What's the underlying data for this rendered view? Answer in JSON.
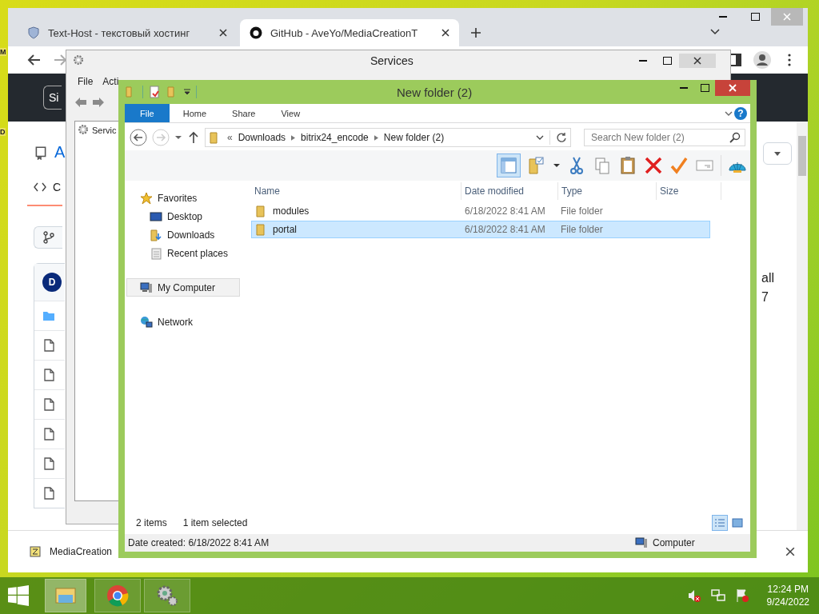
{
  "desktop_icons": [
    {
      "label": "M"
    },
    {
      "label": "D"
    }
  ],
  "browser": {
    "tabs": [
      {
        "title": "Text-Host - текстовый хостинг",
        "selected": false
      },
      {
        "title": "GitHub - AveYo/MediaCreationT",
        "selected": true
      }
    ],
    "page": {
      "sign_in": "Si",
      "repo_name": "A",
      "code_tab": "C",
      "avatar_letter": "D",
      "right_text_1": "all",
      "right_text_2": "7"
    },
    "download_bar": {
      "file": "MediaCreation"
    }
  },
  "services": {
    "title": "Services",
    "menu": [
      "File",
      "Acti"
    ],
    "tree": [
      "Servic"
    ]
  },
  "explorer": {
    "title": "New folder (2)",
    "ribbon_tabs": [
      {
        "label": "File",
        "selected": true
      },
      {
        "label": "Home",
        "selected": false
      },
      {
        "label": "Share",
        "selected": false
      },
      {
        "label": "View",
        "selected": false
      }
    ],
    "address": {
      "overflow": "«",
      "crumbs": [
        "Downloads",
        "bitrix24_encode",
        "New folder (2)"
      ]
    },
    "search": {
      "placeholder": "Search New folder (2)"
    },
    "help": "?",
    "preview_pane_on": true,
    "nav": [
      {
        "label": "Favorites",
        "kind": "star",
        "selected": false,
        "children": [
          {
            "label": "Desktop",
            "kind": "desktop",
            "selected": false
          },
          {
            "label": "Downloads",
            "kind": "downloads",
            "selected": false
          },
          {
            "label": "Recent places",
            "kind": "recent",
            "selected": false
          }
        ]
      },
      {
        "label": "My Computer",
        "kind": "computer",
        "selected": true
      },
      {
        "label": "Network",
        "kind": "network",
        "selected": false
      }
    ],
    "columns": [
      "Name",
      "Date modified",
      "Type",
      "Size"
    ],
    "rows": [
      {
        "name": "modules",
        "date": "6/18/2022 8:41 AM",
        "type": "File folder",
        "selected": false
      },
      {
        "name": "portal",
        "date": "6/18/2022 8:41 AM",
        "type": "File folder",
        "selected": true
      }
    ],
    "status": {
      "count": "2 items",
      "selection": "1 item selected"
    },
    "details": {
      "text": "Date created: 6/18/2022 8:41 AM",
      "location": "Computer"
    }
  },
  "taskbar": {
    "apps": [
      {
        "kind": "explorer",
        "selected": true
      },
      {
        "kind": "chrome",
        "selected": false
      },
      {
        "kind": "services",
        "selected": false
      }
    ],
    "clock": {
      "time": "12:24 PM",
      "date": "9/24/2022"
    }
  }
}
